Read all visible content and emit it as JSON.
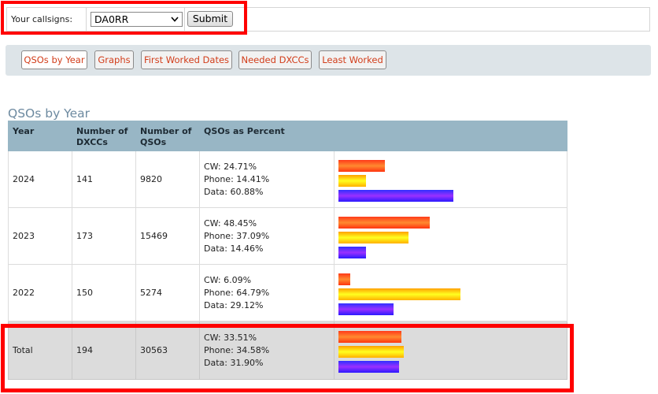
{
  "form": {
    "label": "Your callsigns:",
    "selected_callsign": "DA0RR",
    "submit_label": "Submit"
  },
  "nav": {
    "items": [
      {
        "label": "QSOs by Year"
      },
      {
        "label": "Graphs"
      },
      {
        "label": "First Worked Dates"
      },
      {
        "label": "Needed DXCCs"
      },
      {
        "label": "Least Worked"
      }
    ]
  },
  "section": {
    "title": "QSOs by Year"
  },
  "table": {
    "headers": {
      "year": "Year",
      "dxccs": "Number of DXCCs",
      "qsos": "Number of QSOs",
      "percent": "QSOs as Percent"
    },
    "rows": [
      {
        "year": "2024",
        "dxccs": "141",
        "qsos": "9820",
        "cw": "CW: 24.71%",
        "phone": "Phone: 14.41%",
        "data": "Data: 60.88%",
        "cw_pct": 24.71,
        "phone_pct": 14.41,
        "data_pct": 60.88
      },
      {
        "year": "2023",
        "dxccs": "173",
        "qsos": "15469",
        "cw": "CW: 48.45%",
        "phone": "Phone: 37.09%",
        "data": "Data: 14.46%",
        "cw_pct": 48.45,
        "phone_pct": 37.09,
        "data_pct": 14.46
      },
      {
        "year": "2022",
        "dxccs": "150",
        "qsos": "5274",
        "cw": "CW: 6.09%",
        "phone": "Phone: 64.79%",
        "data": "Data: 29.12%",
        "cw_pct": 6.09,
        "phone_pct": 64.79,
        "data_pct": 29.12
      }
    ],
    "total": {
      "year": "Total",
      "dxccs": "194",
      "qsos": "30563",
      "cw": "CW: 33.51%",
      "phone": "Phone: 34.58%",
      "data": "Data: 31.90%",
      "cw_pct": 33.51,
      "phone_pct": 34.58,
      "data_pct": 31.9
    }
  },
  "colors": {
    "highlight": "#ff0000",
    "nav_text": "#d23d1a",
    "header_bg": "#98b6c5",
    "title": "#6d8aa0"
  },
  "icons": {
    "select_arrow": "chevron-down-icon"
  }
}
